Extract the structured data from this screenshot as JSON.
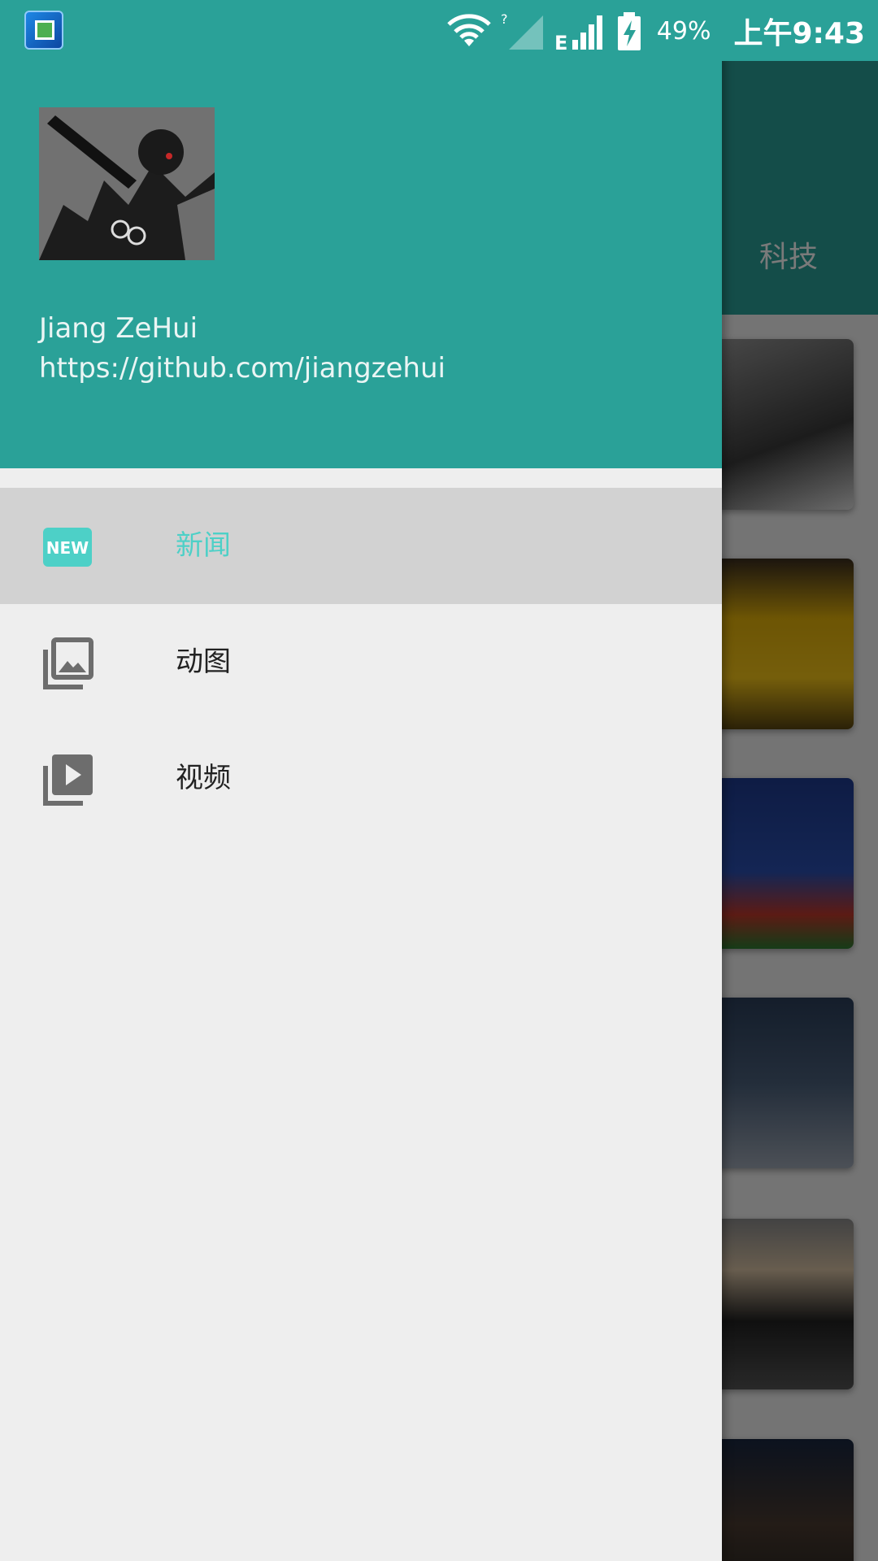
{
  "status_bar": {
    "battery_percent": "49%",
    "time": "上午9:43",
    "icons": [
      "app-notification-icon",
      "wifi-icon",
      "no-sim-signal-icon",
      "edge-network-icon",
      "cell-signal-icon",
      "battery-charging-icon"
    ]
  },
  "background": {
    "tab_label": "科技"
  },
  "drawer": {
    "header": {
      "user_name": "Jiang ZeHui",
      "user_url": "https://github.com/jiangzehui"
    },
    "menu": [
      {
        "label": "新闻",
        "icon": "new-badge-icon",
        "selected": true
      },
      {
        "label": "动图",
        "icon": "photo-library-icon",
        "selected": false
      },
      {
        "label": "视频",
        "icon": "video-library-icon",
        "selected": false
      }
    ]
  },
  "colors": {
    "primary": "#2aa198",
    "accent": "#4dd0c7",
    "drawer_bg": "#eeeeee",
    "selected_bg": "#d2d2d2"
  }
}
